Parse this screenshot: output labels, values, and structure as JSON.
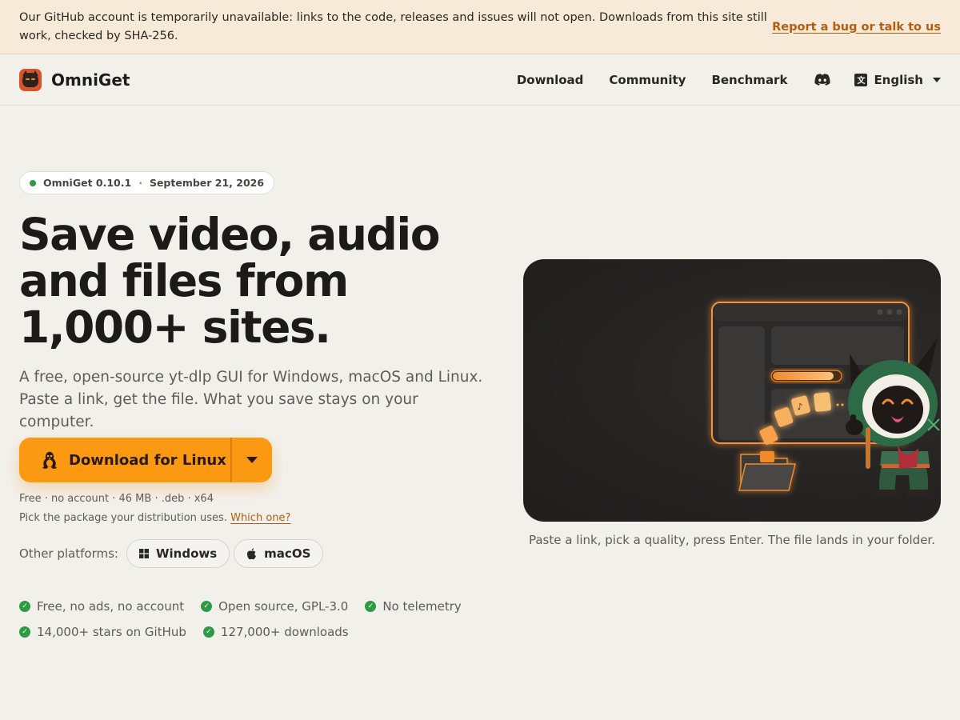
{
  "banner": {
    "text": "Our GitHub account is temporarily unavailable: links to the code, releases and issues will not open. Downloads from this site still work, checked by SHA-256.",
    "link": "Report a bug or talk to us"
  },
  "nav": {
    "brand": "OmniGet",
    "links": [
      "Download",
      "Community",
      "Benchmark"
    ],
    "discord_icon": "discord-icon",
    "language": "English",
    "language_icon": "translate-icon"
  },
  "hero": {
    "version": "OmniGet 0.10.1",
    "date": "September 21, 2026",
    "headline_lines": [
      "Save video, audio",
      "and files from",
      "1,000+ sites."
    ],
    "subhead_lines": [
      "A free, open-source yt-dlp GUI for Windows, macOS and Linux.",
      "Paste a link, get the file. What you save stays on your computer."
    ],
    "download_button": "Download for Linux",
    "download_meta": "Free · no account · 46 MB · .deb · x64",
    "package_hint": "Pick the package your distribution uses.",
    "package_link": "Which one?",
    "platforms_label": "Other platforms:",
    "platforms": [
      "Windows",
      "macOS"
    ],
    "features": [
      [
        "Free, no ads, no account",
        "Open source, GPL-3.0",
        "No telemetry"
      ],
      [
        "14,000+ stars on GitHub",
        "127,000+ downloads"
      ]
    ],
    "caption": "Paste a link, pick a quality, press Enter. The file lands in your folder."
  },
  "colors": {
    "accent": "#fb9a12",
    "link": "#b45d10",
    "success": "#2e9a45",
    "banner_bg": "#f7ead9",
    "page_bg": "#f2f0eb",
    "showcase_bg": "#242322"
  }
}
